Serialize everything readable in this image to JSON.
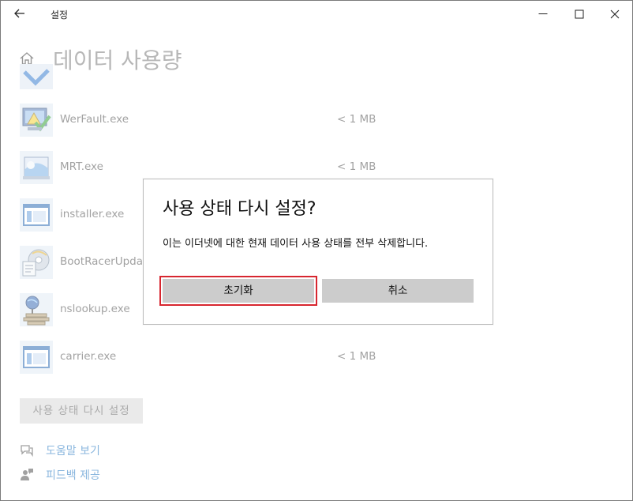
{
  "window": {
    "title": "설정"
  },
  "page": {
    "title": "데이터 사용량"
  },
  "apps": [
    {
      "name": "",
      "size": "",
      "icon": "partial-app-icon"
    },
    {
      "name": "WerFault.exe",
      "size": "< 1 MB",
      "icon": "werfault-icon"
    },
    {
      "name": "MRT.exe",
      "size": "< 1 MB",
      "icon": "mrt-icon"
    },
    {
      "name": "installer.exe",
      "size": "",
      "icon": "window-app-icon"
    },
    {
      "name": "BootRacerUpdate",
      "size": "",
      "icon": "bootracer-icon"
    },
    {
      "name": "nslookup.exe",
      "size": "",
      "icon": "nslookup-icon"
    },
    {
      "name": "carrier.exe",
      "size": "< 1 MB",
      "icon": "window-app-icon"
    }
  ],
  "reset_button": {
    "label": "사용 상태 다시 설정"
  },
  "links": [
    {
      "label": "도움말 보기",
      "icon": "help-chat-icon"
    },
    {
      "label": "피드백 제공",
      "icon": "feedback-person-icon"
    }
  ],
  "dialog": {
    "title": "사용 상태 다시 설정?",
    "message": "이는 이더넷에 대한 현재 데이터 사용 상태를 전부 삭제합니다.",
    "ok_label": "초기화",
    "cancel_label": "취소"
  },
  "colors": {
    "accent": "#2a7cc4",
    "focus_outline": "#d7262f",
    "button": "#cccccc"
  }
}
